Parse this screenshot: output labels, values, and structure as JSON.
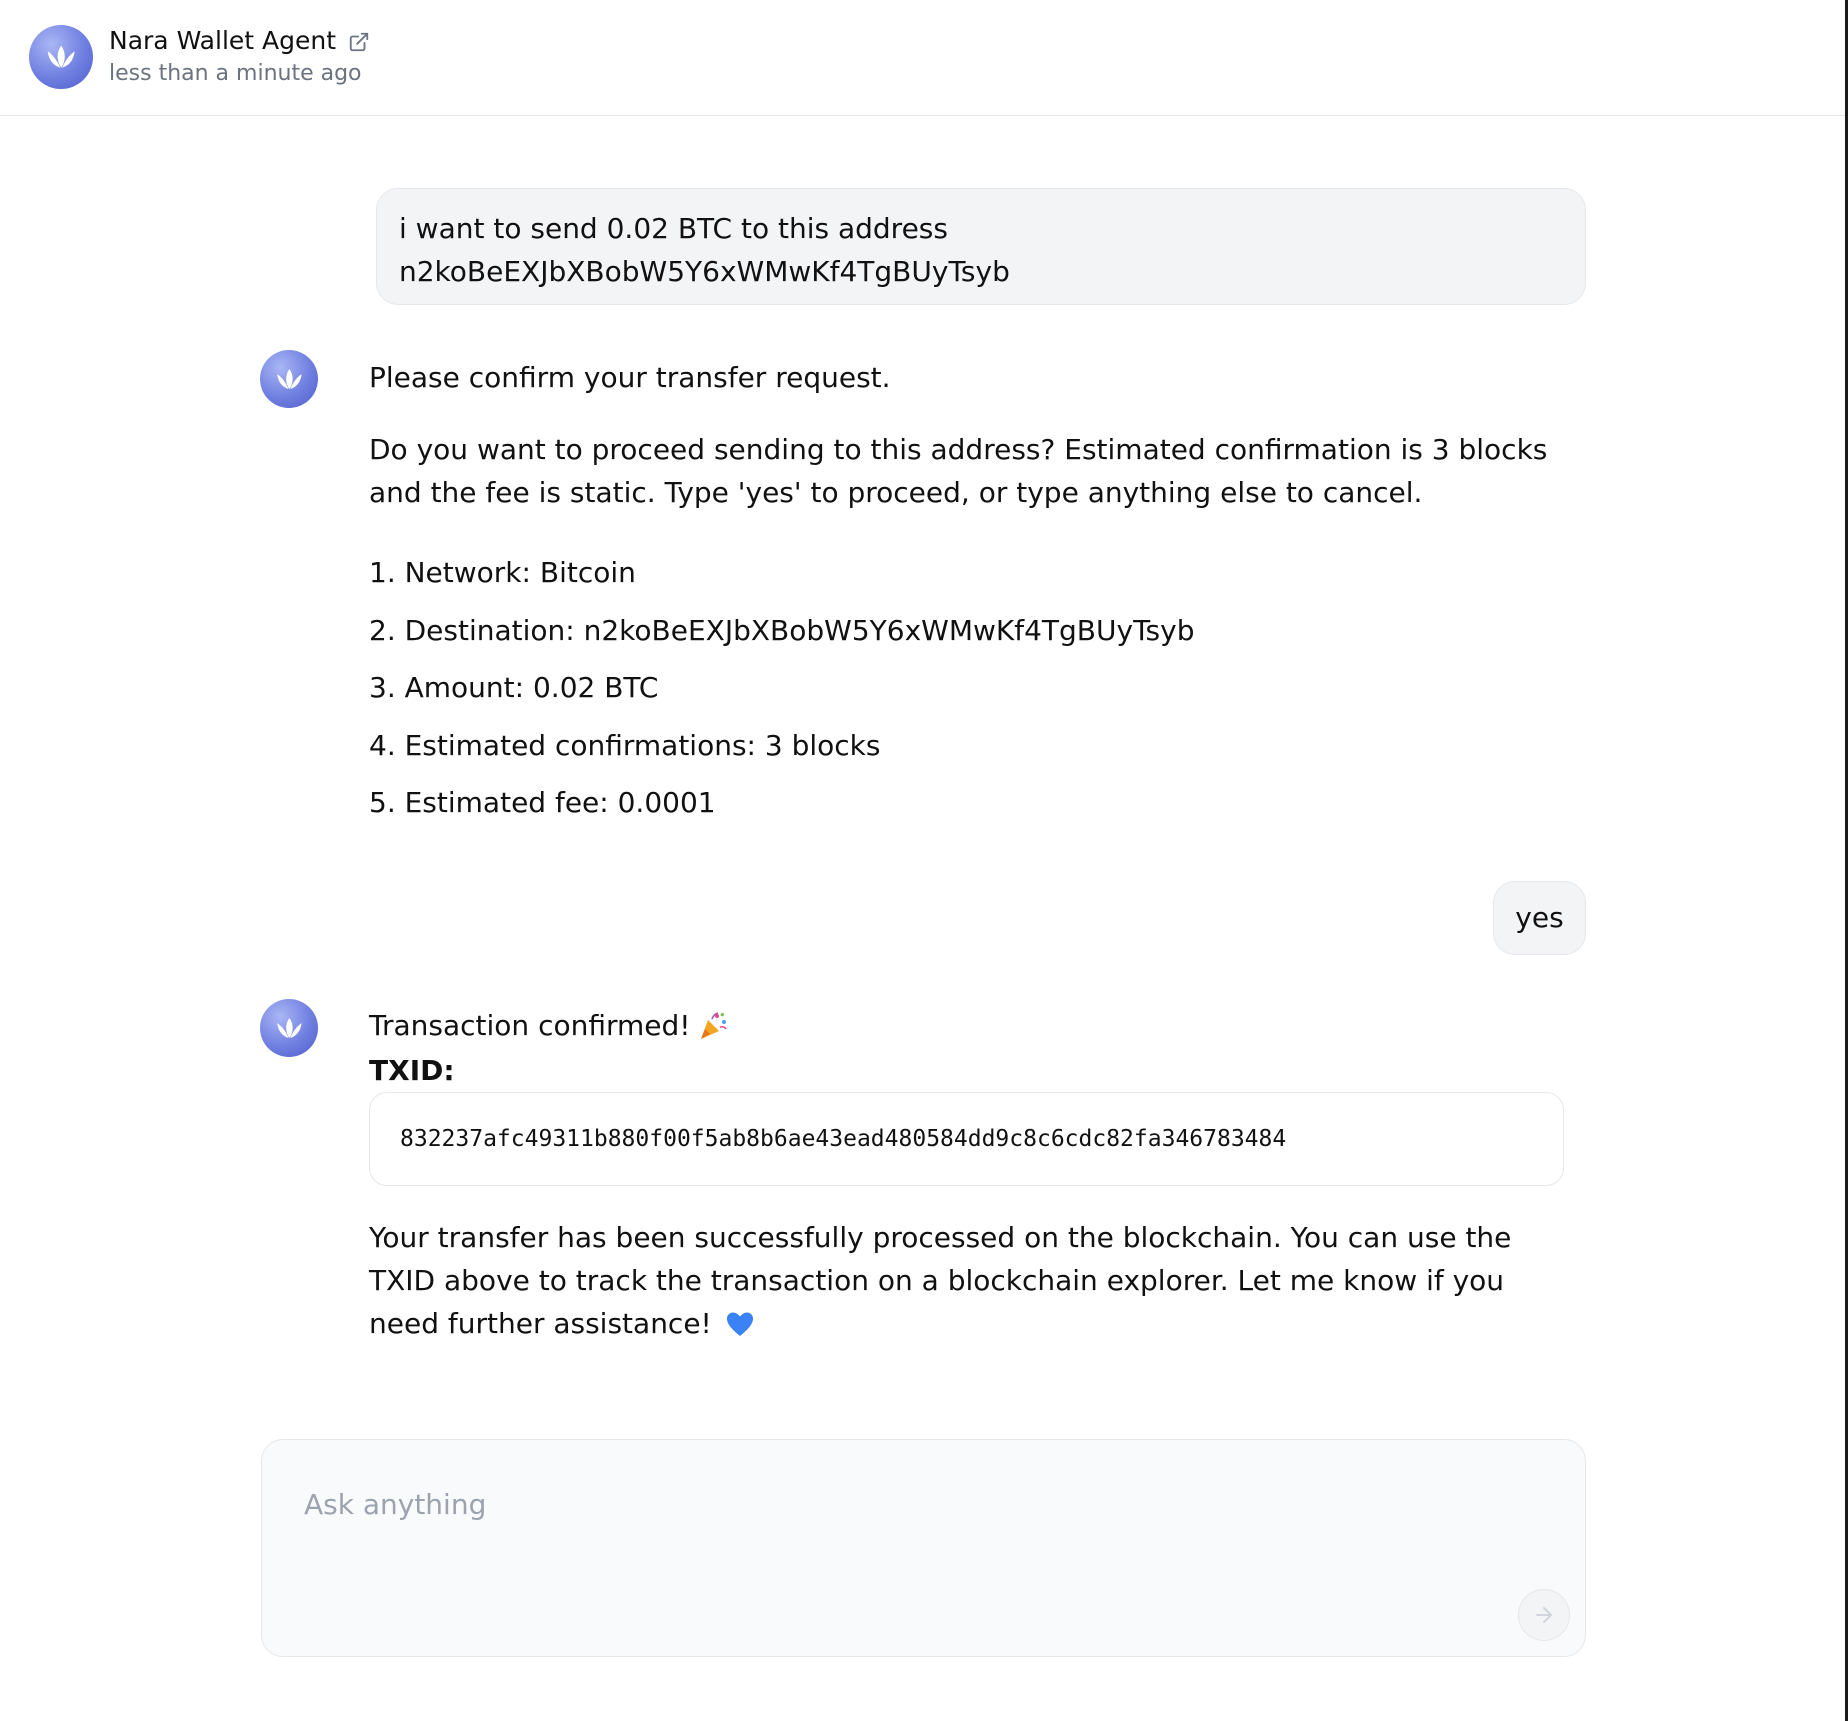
{
  "header": {
    "agent_name": "Nara Wallet Agent",
    "timestamp": "less than a minute ago",
    "external_link_icon": "external-link-icon",
    "logo_icon": "lotus-logo-icon"
  },
  "messages": {
    "user_1": {
      "line1": "i want to send 0.02 BTC to this address",
      "line2": "n2koBeEXJbXBobW5Y6xWMwKf4TgBUyTsyb"
    },
    "agent_1": {
      "title": "Please confirm your transfer request.",
      "body": "Do you want to proceed sending to this address? Estimated confirmation is 3 blocks and the fee is static. Type 'yes' to proceed, or type anything else to cancel.",
      "items": [
        "1. Network: Bitcoin",
        "2. Destination: n2koBeEXJbXBobW5Y6xWMwKf4TgBUyTsyb",
        "3. Amount: 0.02 BTC",
        "4. Estimated confirmations: 3 blocks",
        "5. Estimated fee: 0.0001"
      ]
    },
    "user_2": {
      "text": "yes"
    },
    "agent_2": {
      "title": "Transaction confirmed!",
      "title_icon": "party-popper-icon",
      "txid_label": "TXID:",
      "txid": "832237afc49311b880f00f5ab8b6ae43ead480584dd9c8c6cdc82fa346783484",
      "body": "Your transfer has been successfully processed on the blockchain. You can use the TXID above to track the transaction on a blockchain explorer. Let me know if you need further assistance!",
      "body_icon": "blue-heart-icon"
    }
  },
  "composer": {
    "placeholder": "Ask anything",
    "value": "",
    "send_icon": "arrow-right-icon"
  },
  "colors": {
    "brand": "#6f7fe0",
    "bubble_bg": "#f3f4f6",
    "border": "#e5e7eb",
    "muted_text": "#6b7280",
    "heart": "#3b82f6"
  }
}
